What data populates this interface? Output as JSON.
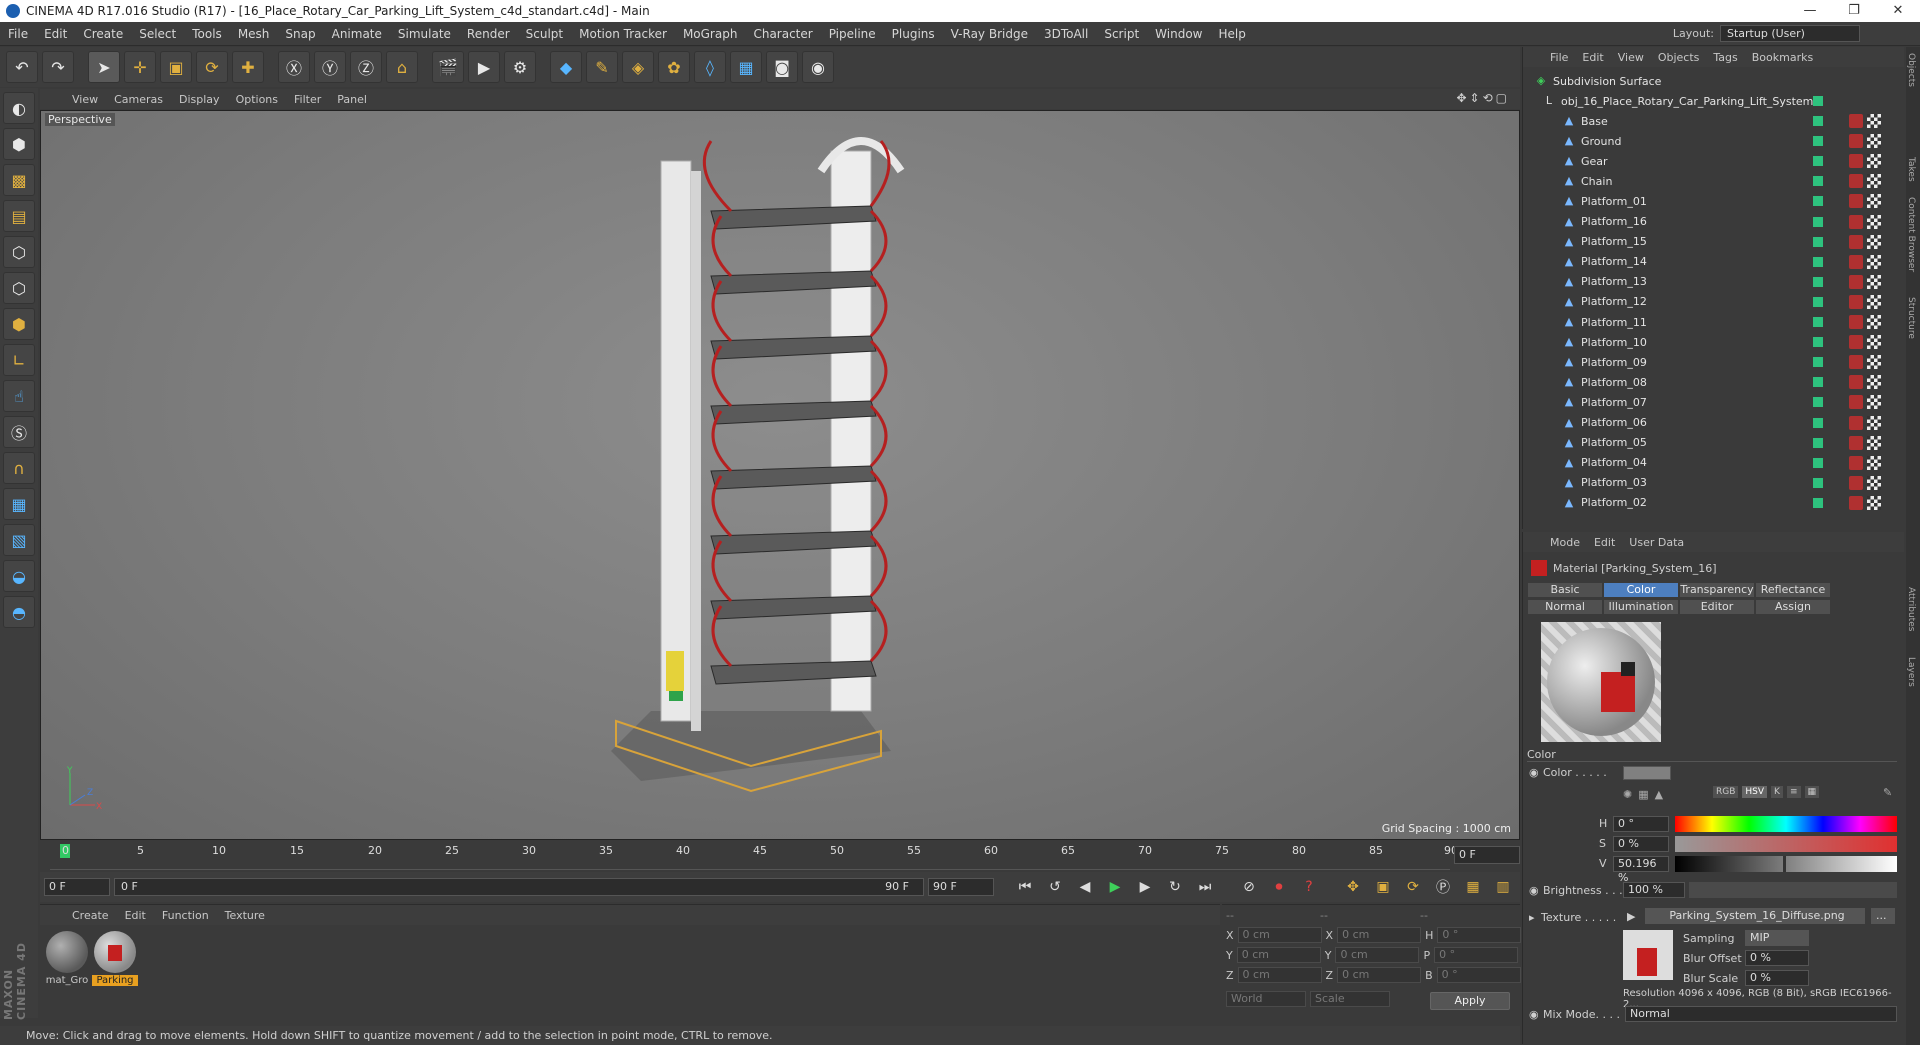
{
  "window": {
    "title": "CINEMA 4D R17.016 Studio (R17) - [16_Place_Rotary_Car_Parking_Lift_System_c4d_standart.c4d] - Main",
    "controls": [
      "—",
      "❐",
      "✕"
    ]
  },
  "menu": [
    "File",
    "Edit",
    "Create",
    "Select",
    "Tools",
    "Mesh",
    "Snap",
    "Animate",
    "Simulate",
    "Render",
    "Sculpt",
    "Motion Tracker",
    "MoGraph",
    "Character",
    "Pipeline",
    "Plugins",
    "V-Ray Bridge",
    "3DToAll",
    "Script",
    "Window",
    "Help"
  ],
  "layout": {
    "label": "Layout:",
    "value": "Startup (User)"
  },
  "viewport": {
    "menu": [
      "View",
      "Cameras",
      "Display",
      "Options",
      "Filter",
      "Panel"
    ],
    "label": "Perspective",
    "grid_spacing": "Grid Spacing : 1000 cm",
    "axis_y": "Y",
    "axis_z": "Z",
    "axis_x": "X"
  },
  "timeline": {
    "ticks": [
      "0",
      "5",
      "10",
      "15",
      "20",
      "25",
      "30",
      "35",
      "40",
      "45",
      "50",
      "55",
      "60",
      "65",
      "70",
      "75",
      "80",
      "85",
      "90"
    ],
    "end_field": "0 F"
  },
  "playback": {
    "start_field": "0 F",
    "slider_left": "0 F",
    "slider_right": "90 F",
    "end_field": "90 F"
  },
  "material_manager": {
    "menu": [
      "Create",
      "Edit",
      "Function",
      "Texture"
    ],
    "materials": [
      {
        "label": "mat_Gro"
      },
      {
        "label": "Parking"
      }
    ]
  },
  "coordinates": {
    "header": [
      "--",
      "--",
      "--"
    ],
    "rows": [
      {
        "a": "X",
        "av": "0 cm",
        "b": "X",
        "bv": "0 cm",
        "c": "H",
        "cv": "0 °"
      },
      {
        "a": "Y",
        "av": "0 cm",
        "b": "Y",
        "bv": "0 cm",
        "c": "P",
        "cv": "0 °"
      },
      {
        "a": "Z",
        "av": "0 cm",
        "b": "Z",
        "bv": "0 cm",
        "c": "B",
        "cv": "0 °"
      }
    ],
    "world": "World",
    "scale": "Scale",
    "apply": "Apply"
  },
  "status": "Move: Click and drag to move elements. Hold down SHIFT to quantize movement / add to the selection in point mode, CTRL to remove.",
  "object_manager": {
    "menu": [
      "File",
      "Edit",
      "View",
      "Objects",
      "Tags",
      "Bookmarks"
    ],
    "root": "Subdivision Surface",
    "group": "obj_16_Place_Rotary_Car_Parking_Lift_System",
    "children": [
      "Base",
      "Ground",
      "Gear",
      "Chain",
      "Platform_01",
      "Platform_16",
      "Platform_15",
      "Platform_14",
      "Platform_13",
      "Platform_12",
      "Platform_11",
      "Platform_10",
      "Platform_09",
      "Platform_08",
      "Platform_07",
      "Platform_06",
      "Platform_05",
      "Platform_04",
      "Platform_03",
      "Platform_02"
    ]
  },
  "attribute_manager": {
    "menu": [
      "Mode",
      "Edit",
      "User Data"
    ],
    "title": "Material [Parking_System_16]",
    "tabs_row1": [
      "Basic",
      "Color",
      "Transparency",
      "Reflectance"
    ],
    "tabs_row2": [
      "Normal",
      "Illumination",
      "Editor",
      "Assign"
    ],
    "active_tab": "Color",
    "section": "Color",
    "color_label": "Color . . . . .",
    "h_label": "H",
    "h_value": "0 °",
    "s_label": "S",
    "s_value": "0 %",
    "v_label": "V",
    "v_value": "50.196 %",
    "brightness_label": "Brightness . . .",
    "brightness_value": "100 %",
    "texture_label": "Texture . . . . .",
    "texture_value": "Parking_System_16_Diffuse.png",
    "texture_btn": "...",
    "sampling_label": "Sampling",
    "sampling_value": "MIP",
    "blur_offset_label": "Blur Offset",
    "blur_offset_value": "0 %",
    "blur_scale_label": "Blur Scale",
    "blur_scale_value": "0 %",
    "resolution": "Resolution 4096 x 4096, RGB (8 Bit), sRGB IEC61966-2...",
    "mixmode_label": "Mix Mode. . . .",
    "mixmode_value": "Normal",
    "hsv_btn": "HSV"
  },
  "side_tabs": [
    "Objects",
    "Takes",
    "Content Browser",
    "Structure",
    "Attributes",
    "Layers"
  ],
  "brand": "MAXON CINEMA 4D"
}
